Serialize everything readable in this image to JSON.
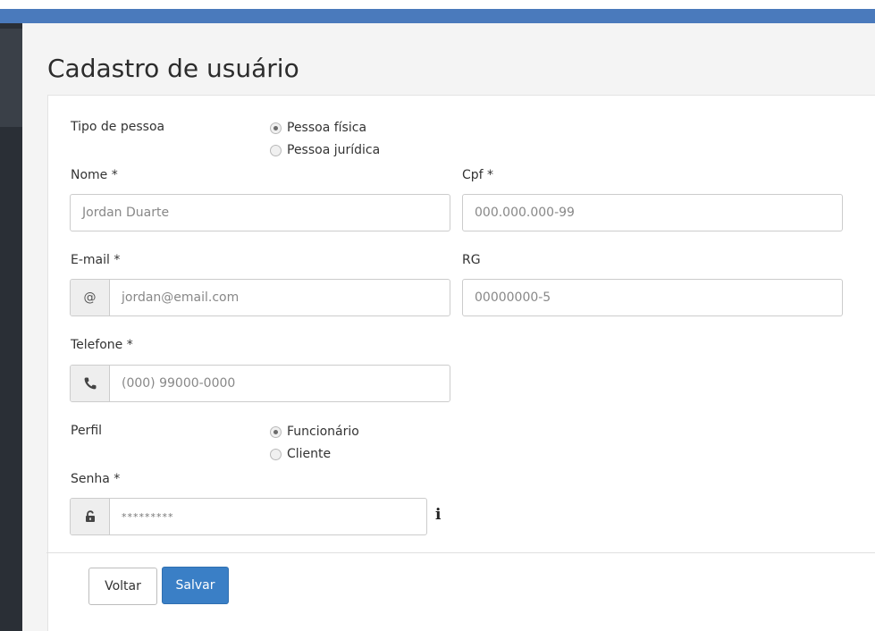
{
  "page": {
    "title": "Cadastro de usuário"
  },
  "form": {
    "tipo_pessoa": {
      "label": "Tipo de pessoa",
      "options": [
        {
          "label": "Pessoa física",
          "checked": true
        },
        {
          "label": "Pessoa jurídica",
          "checked": false
        }
      ]
    },
    "nome": {
      "label": "Nome *",
      "placeholder": "Jordan Duarte"
    },
    "cpf": {
      "label": "Cpf *",
      "placeholder": "000.000.000-99"
    },
    "email": {
      "label": "E-mail *",
      "addon": "@",
      "placeholder": "jordan@email.com"
    },
    "rg": {
      "label": "RG",
      "placeholder": "00000000-5"
    },
    "telefone": {
      "label": "Telefone *",
      "addon_icon": "phone-icon",
      "placeholder": "(000) 99000-0000"
    },
    "perfil": {
      "label": "Perfil",
      "options": [
        {
          "label": "Funcionário",
          "checked": true
        },
        {
          "label": "Cliente",
          "checked": false
        }
      ]
    },
    "senha": {
      "label": "Senha *",
      "addon_icon": "lock-icon",
      "value": "*********",
      "info_icon": "info-icon"
    }
  },
  "actions": {
    "back_label": "Voltar",
    "save_label": "Salvar"
  },
  "colors": {
    "top_bar": "#4a7abc",
    "sidebar": "#2a2f36",
    "primary_button": "#3a7fc6"
  }
}
